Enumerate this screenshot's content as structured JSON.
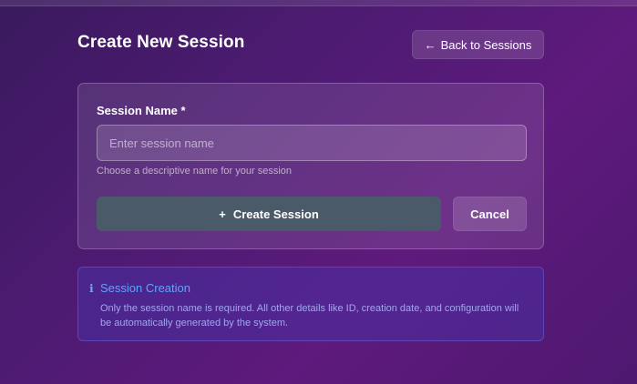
{
  "page": {
    "title": "Create New Session"
  },
  "header": {
    "back_icon": "arrow-left-icon",
    "back_glyph": "←",
    "back_label": "Back to Sessions"
  },
  "form": {
    "name_label": "Session Name *",
    "name_value": "",
    "name_placeholder": "Enter session name",
    "name_hint": "Choose a descriptive name for your session",
    "create_icon": "plus-icon",
    "create_glyph": "+",
    "create_label": "Create Session",
    "cancel_label": "Cancel"
  },
  "info": {
    "icon": "info-icon",
    "icon_glyph": "ℹ",
    "title": "Session Creation",
    "text": "Only the session name is required. All other details like ID, creation date, and configuration will be automatically generated by the system."
  },
  "colors": {
    "background": "#4d1b72",
    "create_button": "#4a5a68",
    "info_accent": "#5ea3ff"
  }
}
